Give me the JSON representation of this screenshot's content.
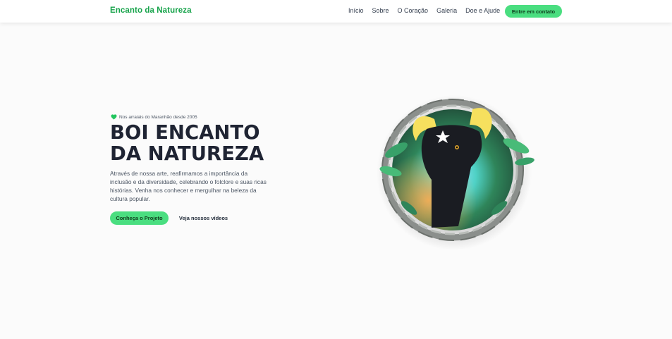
{
  "brand": {
    "name": "Encanto da Natureza",
    "color": "#16a34a"
  },
  "nav": {
    "links": [
      "Início",
      "Sobre",
      "O Coração",
      "Galeria",
      "Doe e Ajude"
    ],
    "cta_label": "Entre em contato"
  },
  "hero": {
    "tagline": "Nos arraiais do Maranhão desde 2005",
    "title_line1": "BOI ENCANTO",
    "title_line2": "DA NATUREZA",
    "description": "Através de nossa arte, reafirmamos a importância da inclusão e da diversidade, celebrando o folclore e suas ricas histórias. Venha nos conhecer e mergulhar na beleza da cultura popular.",
    "primary_button": "Conheça o Projeto",
    "secondary_button": "Veja nossos vídeos",
    "tagline_icon": "heart-icon"
  },
  "colors": {
    "accent": "#4ade80",
    "brand_green": "#16a34a",
    "heading": "#1f2433",
    "body_text": "#4b5563"
  }
}
